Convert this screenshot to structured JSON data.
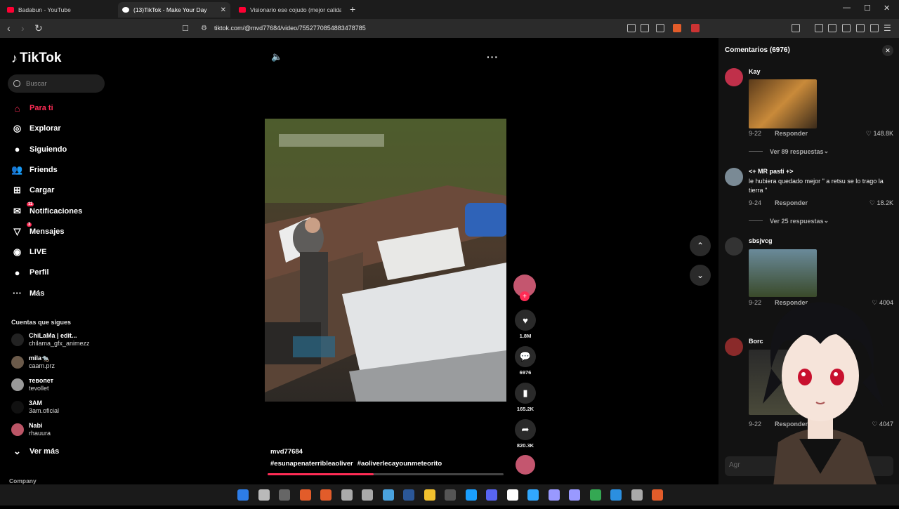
{
  "browser": {
    "tabs": [
      {
        "title": "Badabun - YouTube",
        "color": "#ff0033"
      },
      {
        "title": "(13)TikTok - Make Your Day",
        "color": "#ffffff"
      },
      {
        "title": "Visionario ese cojudo (mejor calidad)",
        "color": "#ff0033"
      }
    ],
    "url": "tiktok.com/@mvd77684/video/7552770854883478785"
  },
  "sidebar": {
    "logo": "TikTok",
    "search_placeholder": "Buscar",
    "menu": [
      {
        "label": "Para ti",
        "icon": "home-icon",
        "glyph": "⌂",
        "badge": ""
      },
      {
        "label": "Explorar",
        "icon": "compass-icon",
        "glyph": "◎",
        "badge": ""
      },
      {
        "label": "Siguiendo",
        "icon": "following-icon",
        "glyph": "●",
        "badge": ""
      },
      {
        "label": "Friends",
        "icon": "friends-icon",
        "glyph": "👥",
        "badge": ""
      },
      {
        "label": "Cargar",
        "icon": "upload-icon",
        "glyph": "⊞",
        "badge": ""
      },
      {
        "label": "Notificaciones",
        "icon": "notifications-icon",
        "glyph": "✉",
        "badge": "11"
      },
      {
        "label": "Mensajes",
        "icon": "messages-icon",
        "glyph": "▽",
        "badge": "3"
      },
      {
        "label": "LIVE",
        "icon": "live-icon",
        "glyph": "◉",
        "badge": ""
      },
      {
        "label": "Perfil",
        "icon": "profile-icon",
        "glyph": "●",
        "badge": ""
      },
      {
        "label": "Más",
        "icon": "more-icon",
        "glyph": "···",
        "badge": ""
      }
    ],
    "following_title": "Cuentas que sigues",
    "accounts": [
      {
        "name": "ChiLaMa | edit...",
        "username": "chilama_gfx_animezz",
        "color": "#222"
      },
      {
        "name": "mila🐀",
        "username": "caam.prz",
        "color": "#6b5a4a"
      },
      {
        "name": "тевопет",
        "username": "tevollet",
        "color": "#999"
      },
      {
        "name": "3AM",
        "username": "3am.oficial",
        "color": "#111"
      },
      {
        "name": "Nabi",
        "username": "rhauura",
        "color": "#b56"
      }
    ],
    "see_more": "Ver más",
    "company": "Company"
  },
  "video": {
    "author": "mvd77684",
    "hashtags": [
      "#esunapenaterribleaoliver",
      "#aoliverlecayounmeteorito"
    ],
    "likes": "1.8M",
    "comments": "6976",
    "saves": "165.2K",
    "shares": "820.3K",
    "progress": 0.45
  },
  "comments_panel": {
    "title": "Comentarios (6976)",
    "reply_label": "Responder",
    "comments": [
      {
        "user": "Kay",
        "text": "",
        "date": "9-22",
        "likes": "148.8K",
        "replies": "Ver 89 respuestas",
        "has_image": true,
        "avatar_color": "#c0304a"
      },
      {
        "user": "<+ MR pasti +>",
        "text": "le hubiera quedado mejor \" a retsu se lo trago la tierra \"",
        "date": "9-24",
        "likes": "18.2K",
        "replies": "Ver 25 respuestas",
        "has_image": false,
        "avatar_color": "#7a8a95"
      },
      {
        "user": "sbsjvcg",
        "text": "",
        "date": "9-22",
        "likes": "4004",
        "replies": "",
        "has_image": true,
        "avatar_color": "#333"
      },
      {
        "user": "Borc",
        "text": "",
        "date": "9-22",
        "likes": "4047",
        "replies": "",
        "has_image": true,
        "avatar_color": "#8a2a2a"
      }
    ],
    "input_placeholder": "Agr"
  }
}
